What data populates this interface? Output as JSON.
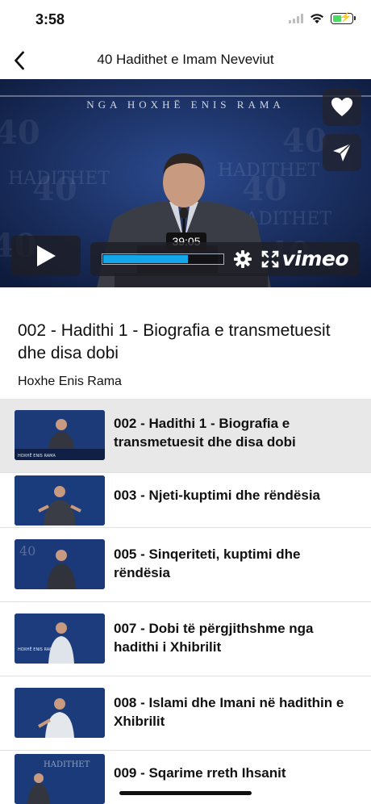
{
  "status": {
    "time": "3:58"
  },
  "nav": {
    "title": "40 Hadithet e Imam Neveviut"
  },
  "player": {
    "banner": "NGA HOXHË ENIS RAMA",
    "time_tooltip": "39:05",
    "progress_fraction": 0.7,
    "brand": "vimeo"
  },
  "current": {
    "title": "002 - Hadithi 1 - Biografia e transmetuesit dhe disa dobi",
    "author": "Hoxhe Enis Rama"
  },
  "playlist": [
    {
      "title": "002 - Hadithi 1 - Biografia e transmetuesit dhe disa dobi",
      "active": true
    },
    {
      "title": "003 - Njeti-kuptimi dhe rëndësia",
      "active": false
    },
    {
      "title": "005 - Sinqeriteti, kuptimi dhe rëndësia",
      "active": false
    },
    {
      "title": "007 - Dobi të përgjithshme nga hadithi i Xhibrilit",
      "active": false
    },
    {
      "title": "008 - Islami dhe Imani në hadithin e Xhibrilit",
      "active": false
    },
    {
      "title": "009 - Sqarime rreth Ihsanit",
      "active": false
    }
  ],
  "colors": {
    "accent": "#13a7e9",
    "active_row": "#e8e8e8",
    "video_bg": "#13244f"
  },
  "icons": {
    "back": "chevron-left-icon",
    "favorite": "heart-icon",
    "share": "send-icon",
    "play": "play-icon",
    "settings": "gear-icon",
    "fullscreen": "expand-icon"
  }
}
